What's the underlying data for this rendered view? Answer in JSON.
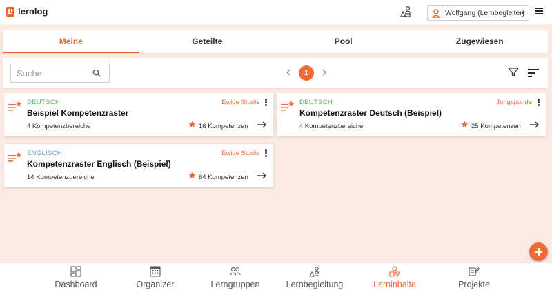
{
  "app": {
    "name": "lernlog",
    "brand_color": "#ee6a3a"
  },
  "header": {
    "user_label": "Wolfgang (Lernbegleiter)",
    "icons": [
      "logo-icon",
      "lernbegleitung-icon",
      "user-icon",
      "menu-icon"
    ]
  },
  "tabs": [
    {
      "label": "Meine",
      "active": true
    },
    {
      "label": "Geteilte",
      "active": false
    },
    {
      "label": "Pool",
      "active": false
    },
    {
      "label": "Zugewiesen",
      "active": false
    }
  ],
  "filterbar": {
    "search_placeholder": "Suche",
    "current_page": "1"
  },
  "cards": [
    {
      "subject": "DEUTSCH",
      "group": "Ewige Studis",
      "title": "Beispiel Kompetenzraster",
      "areas": "4 Kompetenzbereiche",
      "competencies": "16 Kompetenzen"
    },
    {
      "subject": "DEUTSCH",
      "group": "Jungspunde",
      "title": "Kompetenzraster Deutsch (Beispiel)",
      "areas": "4 Kompetenzbereiche",
      "competencies": "25 Kompetenzen"
    },
    {
      "subject": "ENGLISCH",
      "group": "Ewige Studis",
      "title": "Kompetenzraster Englisch (Beispiel)",
      "areas": "14 Kompetenzbereiche",
      "competencies": "64 Kompetenzen"
    }
  ],
  "colors": {
    "deutsch": "#5cb85c",
    "englisch": "#6f9fd3",
    "accent": "#ee6a3a",
    "background": "#fbe9e2"
  },
  "bottomnav": [
    {
      "label": "Dashboard",
      "icon": "dashboard-icon",
      "active": false
    },
    {
      "label": "Organizer",
      "icon": "calendar-icon",
      "active": false
    },
    {
      "label": "Lerngruppen",
      "icon": "group-icon",
      "active": false
    },
    {
      "label": "Lernbegleitung",
      "icon": "lernbegleitung-icon",
      "active": false
    },
    {
      "label": "Lerninhalte",
      "icon": "shapes-icon",
      "active": true
    },
    {
      "label": "Projekte",
      "icon": "projekte-icon",
      "active": false
    }
  ]
}
